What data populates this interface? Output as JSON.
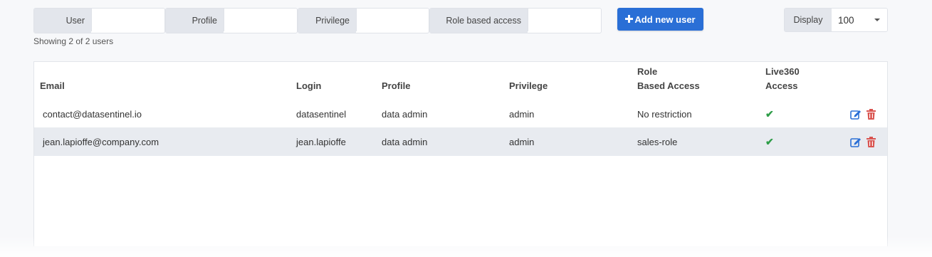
{
  "filters": [
    {
      "label": "User",
      "value": ""
    },
    {
      "label": "Profile",
      "value": ""
    },
    {
      "label": "Privilege",
      "value": ""
    },
    {
      "label": "Role based access",
      "value": ""
    }
  ],
  "add_button": {
    "icon": "plus-icon",
    "label": "Add new user"
  },
  "display": {
    "label": "Display",
    "value": "100"
  },
  "summary": "Showing 2 of 2 users",
  "table": {
    "headers": {
      "email": "Email",
      "login": "Login",
      "profile": "Profile",
      "privilege": "Privilege",
      "role_line1": "Role",
      "role_line2": "Based Access",
      "live_line1": "Live360",
      "live_line2": "Access"
    },
    "rows": [
      {
        "email": "contact@datasentinel.io",
        "login": "datasentinel",
        "profile": "data admin",
        "privilege": "admin",
        "role": "No restriction",
        "live360": "✔"
      },
      {
        "email": "jean.lapioffe@company.com",
        "login": "jean.lapioffe",
        "profile": "data admin",
        "privilege": "admin",
        "role": "sales-role",
        "live360": "✔"
      }
    ]
  },
  "colors": {
    "accent": "#2a6fd6",
    "check": "#2e9d48",
    "delete": "#d9534f",
    "edit": "#2a6fd6"
  }
}
